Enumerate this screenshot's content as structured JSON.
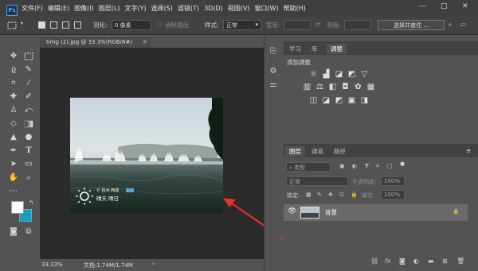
{
  "app": {
    "logo": "Ps"
  },
  "menu": {
    "items": [
      "文件(F)",
      "编辑(E)",
      "图像(I)",
      "图层(L)",
      "文字(Y)",
      "选择(S)",
      "滤镜(T)",
      "3D(D)",
      "视图(V)",
      "窗口(W)",
      "帮助(H)"
    ]
  },
  "window_controls": {
    "minimize": "—",
    "maximize": "□",
    "close": "✕"
  },
  "options": {
    "feather_label": "羽化:",
    "feather_value": "0 像素",
    "antialias_label": "消除锯齿",
    "style_label": "样式:",
    "style_value": "正常",
    "width_label": "宽度:",
    "height_label": "高度:",
    "select_mask_button": "选择并遮住 ..."
  },
  "document": {
    "tab_title": "timg (2).jpg @ 33.3%(RGB/8#)",
    "tab_close": "×",
    "zoom": "33.33%",
    "doc_info": "文档:1.74M/1.74M",
    "status_arrow": "›"
  },
  "photo": {
    "weather_text": "晴天 晴日",
    "watermark_small": "© 杭州 西湖"
  },
  "panel_top": {
    "tabs": [
      "学习",
      "库",
      "调整"
    ],
    "active_tab": "调整",
    "title": "添加调整"
  },
  "layers_panel": {
    "tabs": [
      "图层",
      "通道",
      "路径"
    ],
    "active_tab": "图层",
    "kind_filter": "类型",
    "blend_mode": "正常",
    "opacity_label": "不透明度:",
    "opacity_value": "100%",
    "lock_label": "锁定:",
    "fill_label": "填充:",
    "fill_value": "100%",
    "layers": [
      {
        "name": "背景",
        "visible": true,
        "locked": true
      }
    ]
  },
  "icons": {
    "fx": "fx"
  }
}
